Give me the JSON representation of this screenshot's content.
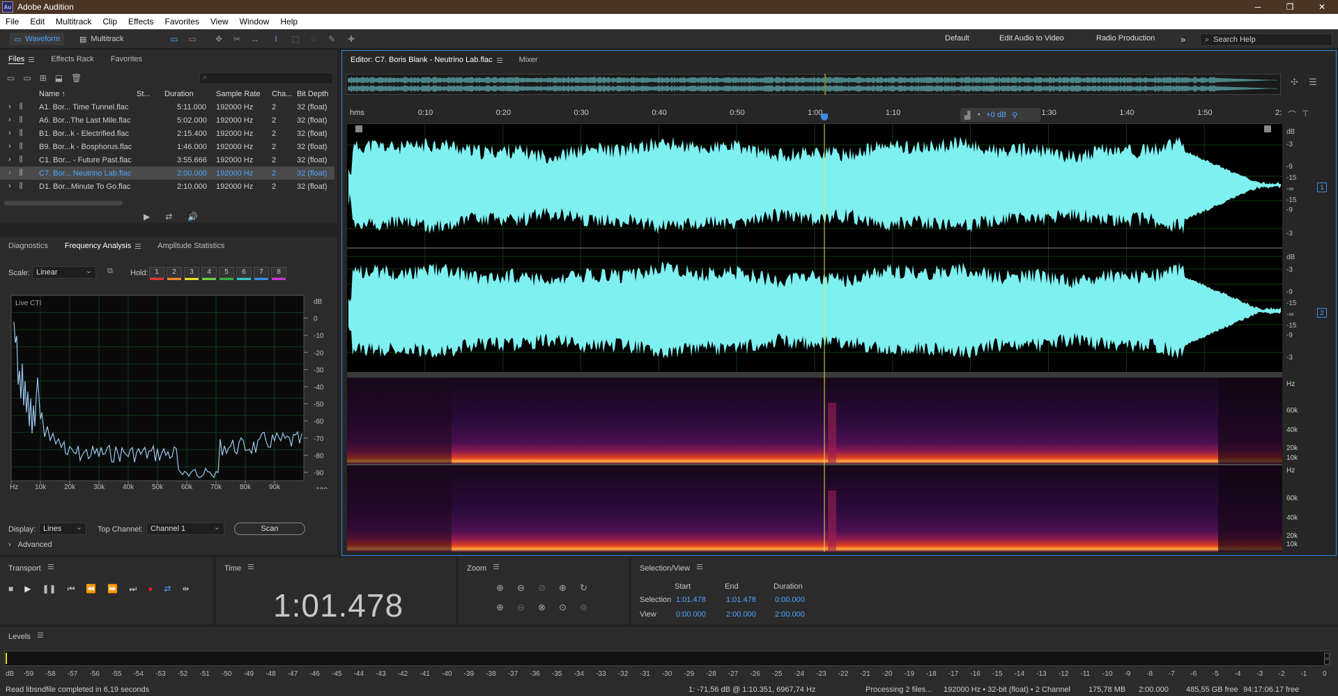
{
  "app": {
    "title": "Adobe Audition",
    "logo": "Au"
  },
  "menu": [
    "File",
    "Edit",
    "Multitrack",
    "Clip",
    "Effects",
    "Favorites",
    "View",
    "Window",
    "Help"
  ],
  "toolbar": {
    "waveform": "Waveform",
    "multitrack": "Multitrack",
    "workspaces": [
      "Default",
      "Edit Audio to Video",
      "Radio Production"
    ],
    "search": "Search Help"
  },
  "files_panel": {
    "tabs": [
      "Files",
      "Effects Rack",
      "Favorites"
    ],
    "columns": [
      "Name",
      "St...",
      "Duration",
      "Sample Rate",
      "Cha...",
      "Bit Depth"
    ],
    "rows": [
      {
        "name": "A1. Bor... Time Tunnel.flac",
        "duration": "5:11.000",
        "rate": "192000 Hz",
        "ch": "2",
        "bits": "32 (float)"
      },
      {
        "name": "A6. Bor...The Last Mile.flac",
        "duration": "5:02.000",
        "rate": "192000 Hz",
        "ch": "2",
        "bits": "32 (float)"
      },
      {
        "name": "B1. Bor...k - Electrified.flac",
        "duration": "2:15.400",
        "rate": "192000 Hz",
        "ch": "2",
        "bits": "32 (float)"
      },
      {
        "name": "B9. Bor...k - Bosphorus.flac",
        "duration": "1:46.000",
        "rate": "192000 Hz",
        "ch": "2",
        "bits": "32 (float)"
      },
      {
        "name": "C1. Bor... - Future Past.flac",
        "duration": "3:55.666",
        "rate": "192000 Hz",
        "ch": "2",
        "bits": "32 (float)"
      },
      {
        "name": "C7. Bor... Neutrino Lab.flac",
        "duration": "2:00.000",
        "rate": "192000 Hz",
        "ch": "2",
        "bits": "32 (float)"
      },
      {
        "name": "D1. Bor...Minute To Go.flac",
        "duration": "2:10.000",
        "rate": "192000 Hz",
        "ch": "2",
        "bits": "32 (float)"
      }
    ],
    "selected_index": 5
  },
  "analysis": {
    "tabs": [
      "Diagnostics",
      "Frequency Analysis",
      "Amplitude Statistics"
    ],
    "scale_label": "Scale:",
    "scale_value": "Linear",
    "hold_label": "Hold:",
    "hold": [
      {
        "n": "1",
        "color": "#e03030"
      },
      {
        "n": "2",
        "color": "#f08a20"
      },
      {
        "n": "3",
        "color": "#e8e020"
      },
      {
        "n": "4",
        "color": "#70d040"
      },
      {
        "n": "5",
        "color": "#30b040"
      },
      {
        "n": "6",
        "color": "#30c8c8"
      },
      {
        "n": "7",
        "color": "#3090f0"
      },
      {
        "n": "8",
        "color": "#d030e0"
      }
    ],
    "graph_label": "Live CTI",
    "db_ticks": [
      "dB",
      "0",
      "-10",
      "-20",
      "-30",
      "-40",
      "-50",
      "-60",
      "-70",
      "-80",
      "-90",
      "-100"
    ],
    "hz_ticks": [
      "Hz",
      "10k",
      "20k",
      "30k",
      "40k",
      "50k",
      "60k",
      "70k",
      "80k",
      "90k"
    ],
    "display_label": "Display:",
    "display_value": "Lines",
    "top_channel_label": "Top Channel:",
    "top_channel_value": "Channel 1",
    "scan": "Scan",
    "advanced": "Advanced"
  },
  "editor": {
    "tab": "Editor: C7. Boris Blank - Neutrino Lab.flac",
    "mixer": "Mixer",
    "ruler": [
      "hms",
      "0:10",
      "0:20",
      "0:30",
      "0:40",
      "0:50",
      "1:00",
      "1:10",
      "1:20",
      "1:30",
      "1:40",
      "1:50",
      "2:"
    ],
    "hud_gain": "+0 dB",
    "wave_db": [
      "dB",
      "-3",
      "-9",
      "-15",
      "-∞",
      "-15",
      "-9",
      "-3"
    ],
    "spec_hz": [
      "Hz",
      "60k",
      "40k",
      "20k",
      "10k"
    ],
    "channels": [
      "1",
      "2"
    ],
    "playhead_time": "1:01.478",
    "wave_color": "#7ff0f0"
  },
  "transport": {
    "title": "Transport"
  },
  "time": {
    "title": "Time",
    "value": "1:01.478"
  },
  "zoom": {
    "title": "Zoom"
  },
  "selection": {
    "title": "Selection/View",
    "headers": [
      "Start",
      "End",
      "Duration"
    ],
    "rows": [
      {
        "label": "Selection",
        "start": "1:01.478",
        "end": "1:01.478",
        "dur": "0:00.000"
      },
      {
        "label": "View",
        "start": "0:00.000",
        "end": "2:00.000",
        "dur": "2:00.000"
      }
    ]
  },
  "levels": {
    "title": "Levels",
    "ticks": [
      "dB",
      "-59",
      "-58",
      "-57",
      "-56",
      "-55",
      "-54",
      "-53",
      "-52",
      "-51",
      "-50",
      "-49",
      "-48",
      "-47",
      "-46",
      "-45",
      "-44",
      "-43",
      "-42",
      "-41",
      "-40",
      "-39",
      "-38",
      "-37",
      "-36",
      "-35",
      "-34",
      "-33",
      "-32",
      "-31",
      "-30",
      "-29",
      "-28",
      "-27",
      "-26",
      "-25",
      "-24",
      "-23",
      "-22",
      "-21",
      "-20",
      "-19",
      "-18",
      "-17",
      "-16",
      "-15",
      "-14",
      "-13",
      "-12",
      "-11",
      "-10",
      "-9",
      "-8",
      "-7",
      "-6",
      "-5",
      "-4",
      "-3",
      "-2",
      "-1",
      "0"
    ]
  },
  "status": {
    "left": "Read libsndfile completed in 6,19 seconds",
    "cursor": "1: -71,56 dB @ 1:10.351, 6967,74 Hz",
    "processing": "Processing 2 files...",
    "format": "192000 Hz • 32-bit (float) • 2 Channel",
    "size": "175,78 MB",
    "duration": "2:00.000",
    "free": "485,55 GB free",
    "free_time": "94:17:06.17 free"
  }
}
